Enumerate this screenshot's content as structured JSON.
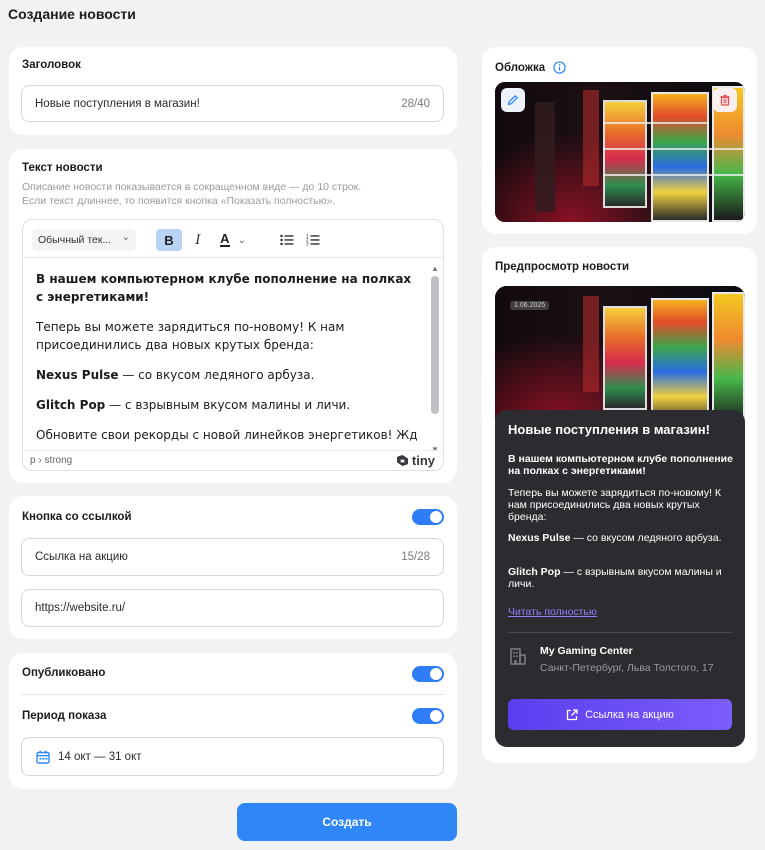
{
  "page": {
    "title": "Создание новости"
  },
  "headline": {
    "label": "Заголовок",
    "value": "Новые поступления в магазин!",
    "counter": "28/40"
  },
  "body": {
    "label": "Текст новости",
    "hint_line1": "Описание новости показывается в сокращенном виде — до 10 строк.",
    "hint_line2": "Если текст длиннее, то появится кнопка «Показать полностью».",
    "editor": {
      "format_select": "Обычный тек...",
      "bold_label": "B",
      "italic_label": "I",
      "color_label": "A",
      "p1": "В нашем компьютерном клубе пополнение на полках с энергетиками!",
      "p2": "Теперь вы можете зарядиться по-новому! К нам присоединились два новых крутых бренда:",
      "p3_brand": "Nexus Pulse",
      "p3_rest": " — со вкусом ледяного арбуза.",
      "p4_brand": "Glitch Pop",
      "p4_rest": " — с взрывным вкусом малины и личи.",
      "p5": "Обновите свои рекорды с новой линейков энергетиков! Ждём",
      "status_path": "p › strong",
      "brand": "tiny"
    }
  },
  "link_button": {
    "label": "Кнопка со ссылкой",
    "enabled": true,
    "text_value": "Ссылка на акцию",
    "text_counter": "15/28",
    "url_value": "https://website.ru/"
  },
  "publish": {
    "published_label": "Опубликовано",
    "published": true,
    "period_label": "Период показа",
    "period_enabled": true,
    "date_range": "14 окт — 31 окт"
  },
  "actions": {
    "create_label": "Создать"
  },
  "cover": {
    "label": "Обложка"
  },
  "preview": {
    "label": "Предпросмотр новости",
    "date": "1.06.2025",
    "title": "Новые поступления в магазин!",
    "lead": "В нашем компьютерном клубе пополнение на полках с энергетиками!",
    "p1": "Теперь вы можете зарядиться по-новому! К нам присоединились два новых крутых бренда:",
    "p2_brand": "Nexus Pulse",
    "p2_rest": " — со вкусом ледяного арбуза.",
    "p3_brand": "Glitch Pop",
    "p3_rest": " — с взрывным вкусом малины и личи.",
    "read_more": "Читать полностью",
    "venue_name": "My Gaming Center",
    "venue_address": "Санкт-Петербург, Льва Толстого, 17",
    "button_label": "Ссылка на акцию"
  },
  "colors": {
    "accent": "#2e86f7",
    "toggle": "#2e7df6",
    "preview_button": "#6a4cf5",
    "link": "#9b7bff"
  }
}
